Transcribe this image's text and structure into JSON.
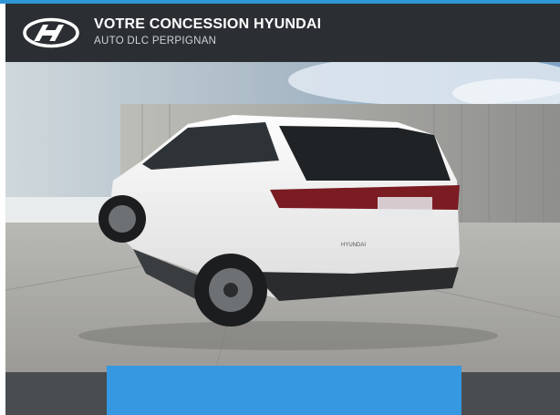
{
  "header": {
    "title": "VOTRE CONCESSION HYUNDAI",
    "subtitle": "AUTO DLC PERPIGNAN",
    "logo_icon": "hyundai-logo-icon"
  },
  "photo": {
    "badge_text": "HYUNDAI",
    "subject": "car-photo"
  },
  "colors": {
    "accent": "#2f96d6",
    "header_bg": "#2b2f33",
    "cta_bg": "#3598e0",
    "bottom_bg": "#4a4d50"
  }
}
